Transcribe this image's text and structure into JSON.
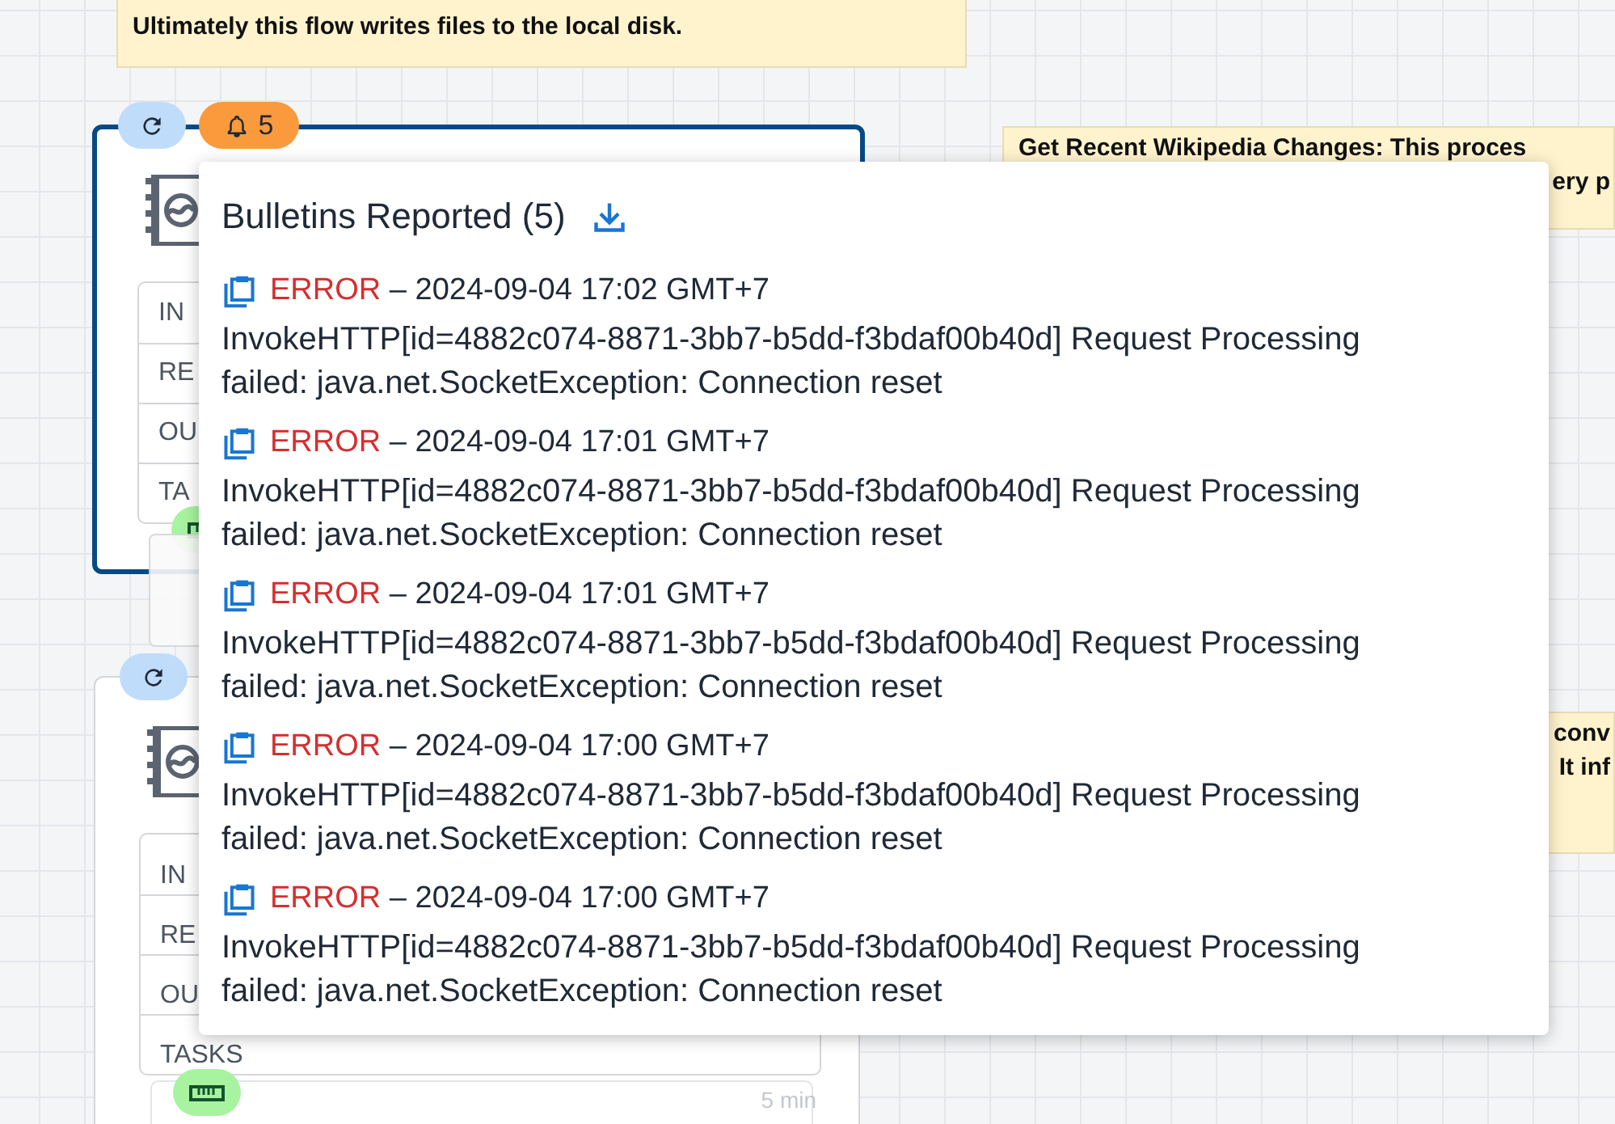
{
  "notes": [
    {
      "lines": [
        "Ultimately this flow writes files to the local disk."
      ]
    },
    {
      "lines": [
        "Get Recent Wikipedia Changes: This proces",
        "ery p"
      ]
    },
    {
      "lines": [
        "conv",
        "It inf"
      ]
    }
  ],
  "processors": [
    {
      "selected": true,
      "badges": [
        {
          "kind": "refresh"
        },
        {
          "kind": "bulletin",
          "count": "5"
        }
      ],
      "stats": [
        "IN",
        "RE",
        "OU",
        "TA"
      ],
      "status": {
        "kind": "running"
      }
    },
    {
      "selected": false,
      "badges": [
        {
          "kind": "refresh"
        }
      ],
      "stats": [
        "IN",
        "RE",
        "OU",
        "TASKS"
      ],
      "status": {
        "kind": "running"
      },
      "footer": "5 min"
    }
  ],
  "bulletins": {
    "title": "Bulletins Reported (5)",
    "items": [
      {
        "level": "ERROR",
        "time": " – 2024-09-04 17:02 GMT+7",
        "message": "InvokeHTTP[id=4882c074-8871-3bb7-b5dd-f3bdaf00b40d] Request Processing failed: java.net.SocketException: Connection reset"
      },
      {
        "level": "ERROR",
        "time": " – 2024-09-04 17:01 GMT+7",
        "message": "InvokeHTTP[id=4882c074-8871-3bb7-b5dd-f3bdaf00b40d] Request Processing failed: java.net.SocketException: Connection reset"
      },
      {
        "level": "ERROR",
        "time": " – 2024-09-04 17:01 GMT+7",
        "message": "InvokeHTTP[id=4882c074-8871-3bb7-b5dd-f3bdaf00b40d] Request Processing failed: java.net.SocketException: Connection reset"
      },
      {
        "level": "ERROR",
        "time": " – 2024-09-04 17:00 GMT+7",
        "message": "InvokeHTTP[id=4882c074-8871-3bb7-b5dd-f3bdaf00b40d] Request Processing failed: java.net.SocketException: Connection reset"
      },
      {
        "level": "ERROR",
        "time": " – 2024-09-04 17:00 GMT+7",
        "message": "InvokeHTTP[id=4882c074-8871-3bb7-b5dd-f3bdaf00b40d] Request Processing failed: java.net.SocketException: Connection reset"
      }
    ]
  }
}
